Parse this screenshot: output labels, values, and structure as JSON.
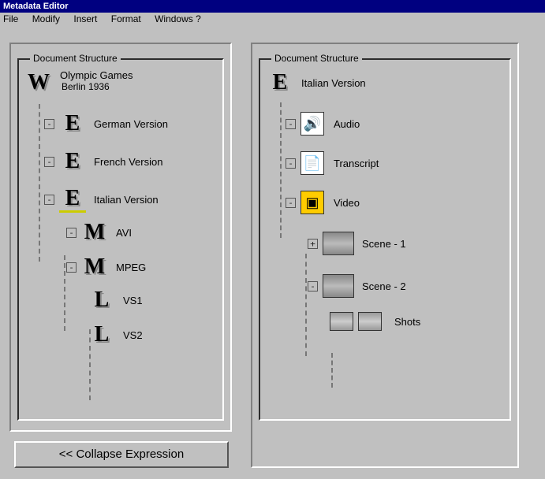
{
  "window_title": "Metadata Editor",
  "menu": {
    "file": "File",
    "modify": "Modify",
    "insert": "Insert",
    "format": "Format",
    "windows": "Windows ?"
  },
  "legend": "Document Structure",
  "left_tree": {
    "root": {
      "glyph": "W",
      "label": "Olympic Games",
      "sub": "Berlin 1936"
    },
    "children": [
      {
        "glyph": "E",
        "label": "German Version"
      },
      {
        "glyph": "E",
        "label": "French Version"
      },
      {
        "glyph": "E",
        "label": "Italian Version",
        "children": [
          {
            "glyph": "M",
            "label": "AVI"
          },
          {
            "glyph": "M",
            "label": "MPEG",
            "children": [
              {
                "glyph": "L",
                "label": "VS1"
              },
              {
                "glyph": "L",
                "label": "VS2"
              }
            ]
          }
        ]
      }
    ]
  },
  "right_tree": {
    "root": {
      "glyph": "E",
      "label": "Italian Version"
    },
    "children": [
      {
        "kind": "audio",
        "label": "Audio"
      },
      {
        "kind": "transcript",
        "label": "Transcript"
      },
      {
        "kind": "video",
        "label": "Video",
        "children": [
          {
            "kind": "scene",
            "label": "Scene - 1"
          },
          {
            "kind": "scene",
            "label": "Scene - 2",
            "children": [
              {
                "kind": "shots",
                "label": "Shots"
              }
            ]
          }
        ]
      }
    ]
  },
  "collapse_label": "<< Collapse Expression"
}
